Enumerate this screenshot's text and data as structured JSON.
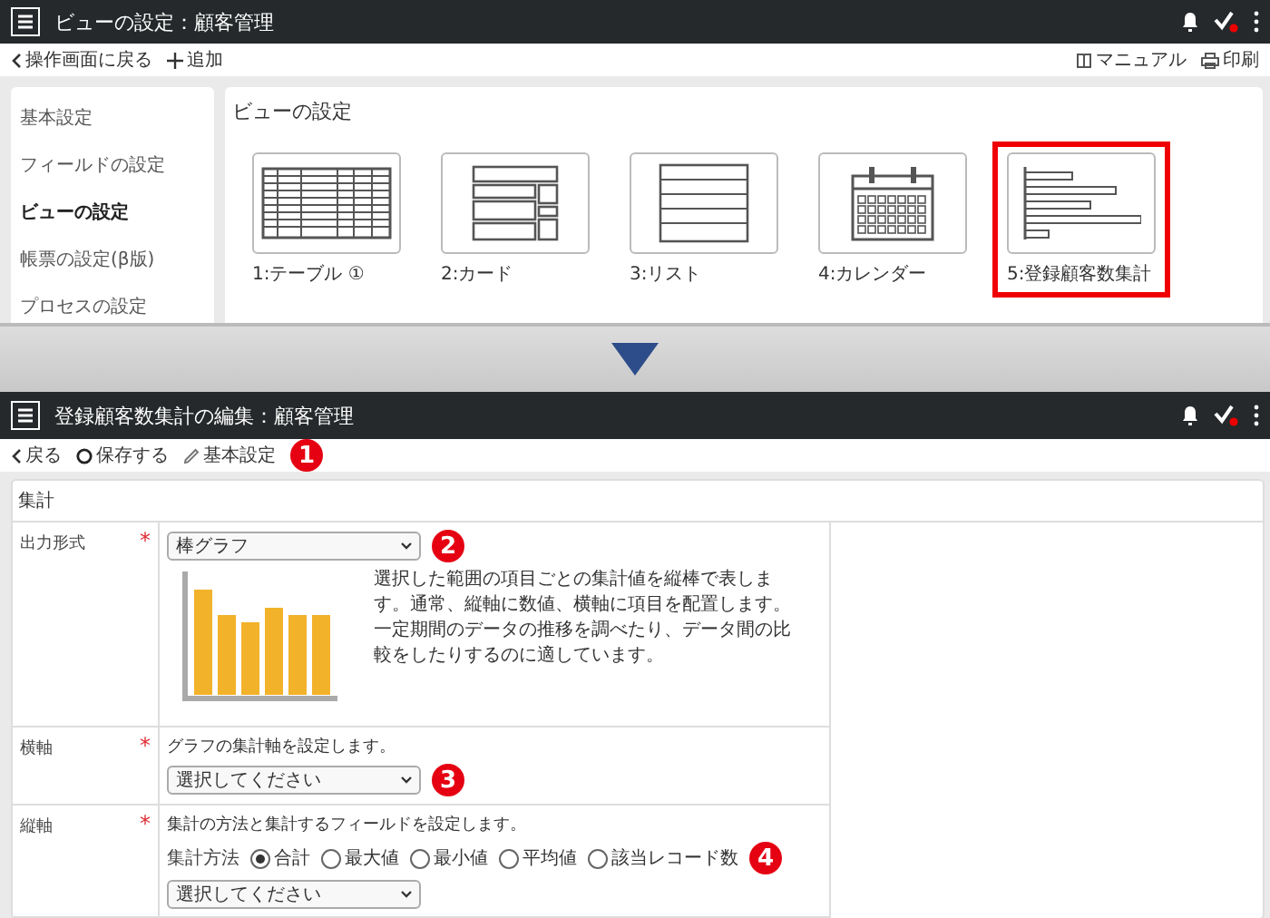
{
  "top_screen": {
    "header": {
      "title": "ビューの設定：顧客管理"
    },
    "toolbar": {
      "back": "操作画面に戻る",
      "add": "追加",
      "manual": "マニュアル",
      "print": "印刷"
    },
    "sidebar": {
      "items": [
        {
          "label": "基本設定",
          "selected": false
        },
        {
          "label": "フィールドの設定",
          "selected": false
        },
        {
          "label": "ビューの設定",
          "selected": true
        },
        {
          "label": "帳票の設定(β版)",
          "selected": false
        },
        {
          "label": "プロセスの設定",
          "selected": false
        }
      ]
    },
    "panel": {
      "title": "ビューの設定",
      "views": [
        {
          "kind": "table",
          "label": "1:テーブル ①",
          "highlighted": false
        },
        {
          "kind": "card",
          "label": "2:カード",
          "highlighted": false
        },
        {
          "kind": "list",
          "label": "3:リスト",
          "highlighted": false
        },
        {
          "kind": "calendar",
          "label": "4:カレンダー",
          "highlighted": false
        },
        {
          "kind": "aggregate",
          "label": "5:登録顧客数集計",
          "highlighted": true
        }
      ]
    }
  },
  "bottom_screen": {
    "header": {
      "title": "登録顧客数集計の編集：顧客管理"
    },
    "toolbar": [
      {
        "kind": "back",
        "label": "戻る"
      },
      {
        "kind": "save",
        "label": "保存する"
      },
      {
        "kind": "settings",
        "label": "基本設定"
      }
    ],
    "toolbar_callout": "1",
    "section_title": "集計",
    "fields": [
      {
        "kind": "chart_type",
        "label": "出力形式",
        "required_mark": "*",
        "value": "棒グラフ",
        "callout": "2",
        "description": "選択した範囲の項目ごとの集計値を縦棒で表します。通常、縦軸に数値、横軸に項目を配置します。一定期間のデータの推移を調べたり、データ間の比較をしたりするのに適しています。"
      },
      {
        "kind": "select",
        "label": "横軸",
        "required_mark": "*",
        "hint": "グラフの集計軸を設定します。",
        "placeholder": "選択してください",
        "callout": "3"
      },
      {
        "kind": "aggregate",
        "label": "縦軸",
        "required_mark": "*",
        "hint": "集計の方法と集計するフィールドを設定します。",
        "method_label": "集計方法",
        "callout": "4",
        "placeholder": "選択してください",
        "methods": [
          {
            "label": "合計",
            "selected": true
          },
          {
            "label": "最大値",
            "selected": false
          },
          {
            "label": "最小値",
            "selected": false
          },
          {
            "label": "平均値",
            "selected": false
          },
          {
            "label": "該当レコード数",
            "selected": false
          }
        ]
      }
    ]
  }
}
